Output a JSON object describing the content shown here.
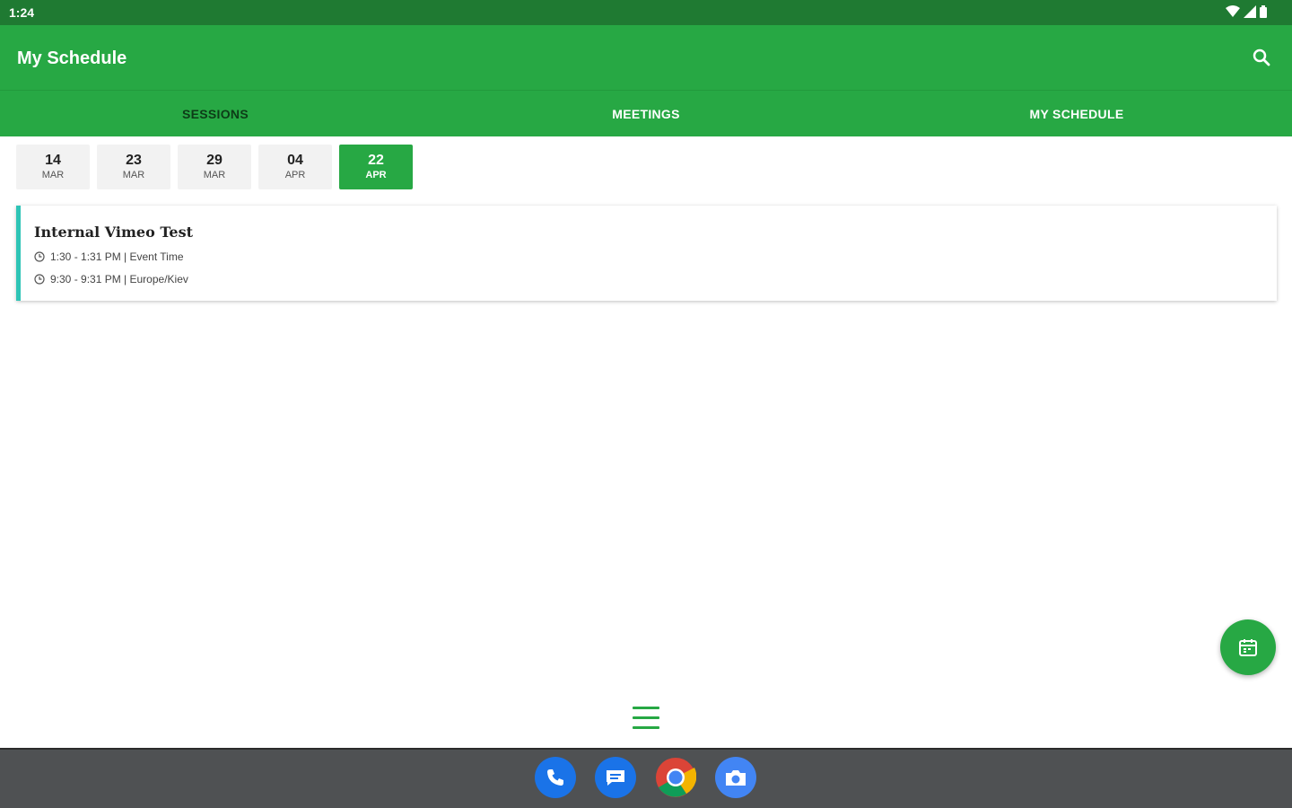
{
  "status_bar": {
    "time": "1:24"
  },
  "app_bar": {
    "title": "My Schedule"
  },
  "tabs": [
    {
      "label": "SESSIONS",
      "active": true
    },
    {
      "label": "MEETINGS",
      "active": false
    },
    {
      "label": "MY SCHEDULE",
      "active": false
    }
  ],
  "dates": [
    {
      "day": "14",
      "month": "MAR",
      "selected": false
    },
    {
      "day": "23",
      "month": "MAR",
      "selected": false
    },
    {
      "day": "29",
      "month": "MAR",
      "selected": false
    },
    {
      "day": "04",
      "month": "APR",
      "selected": false
    },
    {
      "day": "22",
      "month": "APR",
      "selected": true
    }
  ],
  "session": {
    "title": "Internal Vimeo Test",
    "event_time": "1:30 - 1:31 PM | Event Time",
    "local_time": "9:30 - 9:31 PM | Europe/Kiev"
  },
  "colors": {
    "primary": "#27a844",
    "status_bar": "#1f7a32",
    "card_accent": "#2ec4b6"
  },
  "icons": {
    "search": "search-icon",
    "fab": "calendar-icon",
    "menu": "hamburger-menu-icon"
  },
  "dock": [
    "phone-icon",
    "messages-icon",
    "chrome-icon",
    "camera-icon"
  ]
}
